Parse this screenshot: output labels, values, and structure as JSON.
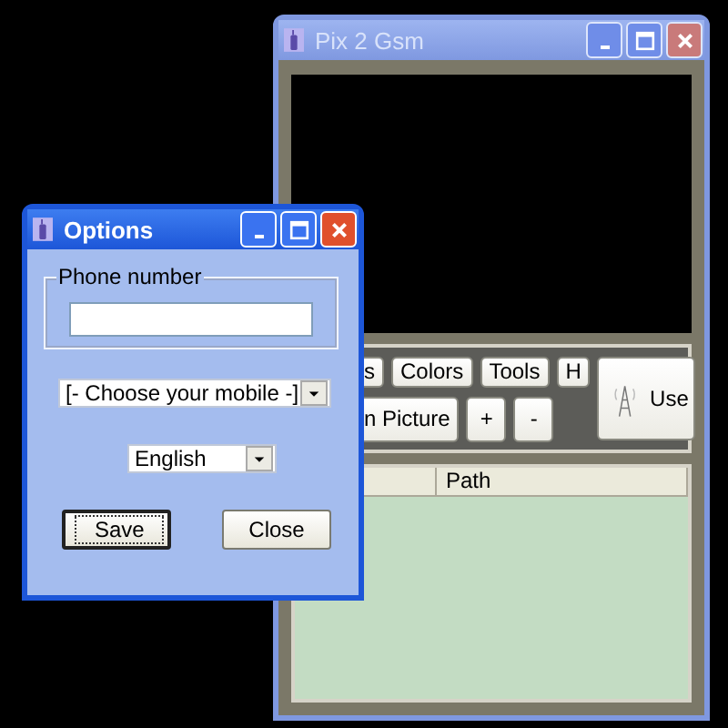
{
  "main_window": {
    "title": "Pix 2 Gsm",
    "active": false,
    "toolbar": {
      "top_buttons": [
        {
          "label": "s",
          "cut": true
        },
        {
          "label": "Colors",
          "cut": false
        },
        {
          "label": "Tools",
          "cut": false
        },
        {
          "label": "H",
          "cut": false
        }
      ],
      "bottom_buttons": [
        {
          "label": "n Picture",
          "cut": true
        },
        {
          "label": "+",
          "cut": false
        },
        {
          "label": "-",
          "cut": false
        }
      ],
      "use_button": {
        "label": "Use"
      }
    },
    "list": {
      "columns": [
        {
          "label": "Path"
        }
      ]
    }
  },
  "options_dialog": {
    "title": "Options",
    "active": true,
    "phone_number": {
      "label": "Phone number"
    },
    "mobile_select": {
      "value": "[- Choose your mobile -]"
    },
    "language_select": {
      "value": "English"
    },
    "buttons": [
      {
        "label": "Save",
        "focused": true
      },
      {
        "label": "Close",
        "focused": false
      }
    ]
  }
}
